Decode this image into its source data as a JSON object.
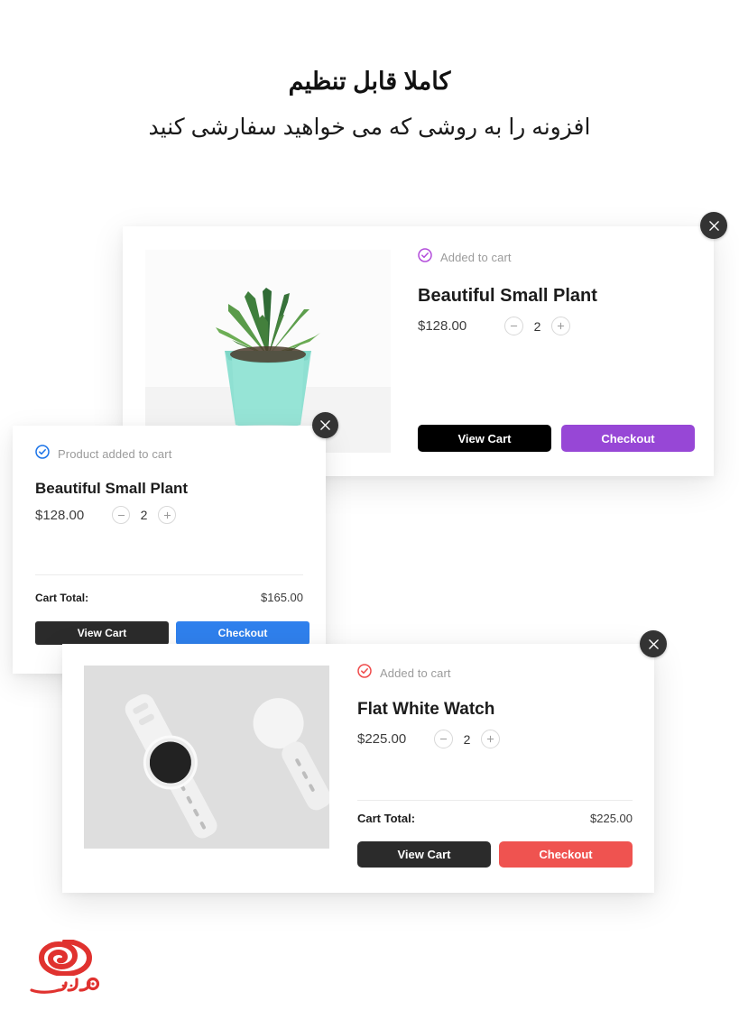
{
  "heading": {
    "title": "کاملا قابل تنظیم",
    "subtitle": "افزونه را به روشی که می خواهید سفارشی کنید"
  },
  "colors": {
    "page_background": "#ffffff",
    "card_background": "#ffffff",
    "purple_checkout": "#9747d6",
    "blue_checkout": "#2f80ed",
    "red_checkout": "#ef5350",
    "black_viewcart": "#000000",
    "dark_viewcart": "#2b2b2b",
    "close_button": "#333333",
    "status_text": "#9b9b9b",
    "check_purple": "#b34ddb",
    "check_blue": "#1a73e8",
    "check_red": "#ef4a4a",
    "logo_red": "#e0322f"
  },
  "cards": [
    {
      "id": "card1",
      "close_icon": "close-icon",
      "status": {
        "icon": "check-circle-icon",
        "icon_color": "#b34ddb",
        "text": "Added to cart"
      },
      "product": {
        "title": "Beautiful Small Plant",
        "price": "$128.00",
        "image_alt": "succulent-plant-in-mint-pot"
      },
      "stepper": {
        "decrease_icon": "minus-icon",
        "increase_icon": "plus-icon",
        "quantity": "2"
      },
      "has_total": false,
      "total": {
        "label": "",
        "value": ""
      },
      "buttons": {
        "view_cart": "View Cart",
        "checkout": "Checkout",
        "view_cart_color": "#000000",
        "checkout_color": "#9747d6"
      }
    },
    {
      "id": "card2",
      "close_icon": "close-icon",
      "status": {
        "icon": "check-circle-icon",
        "icon_color": "#1a73e8",
        "text": "Product added to cart"
      },
      "product": {
        "title": "Beautiful Small Plant",
        "price": "$128.00",
        "image_alt": ""
      },
      "stepper": {
        "decrease_icon": "minus-icon",
        "increase_icon": "plus-icon",
        "quantity": "2"
      },
      "has_total": true,
      "total": {
        "label": "Cart Total:",
        "value": "$165.00"
      },
      "buttons": {
        "view_cart": "View Cart",
        "checkout": "Checkout",
        "view_cart_color": "#2b2b2b",
        "checkout_color": "#2f80ed"
      }
    },
    {
      "id": "card3",
      "close_icon": "close-icon",
      "status": {
        "icon": "check-circle-icon",
        "icon_color": "#ef4a4a",
        "text": "Added to cart"
      },
      "product": {
        "title": "Flat White Watch",
        "price": "$225.00",
        "image_alt": "white-smartwatches-on-gray-background"
      },
      "stepper": {
        "decrease_icon": "minus-icon",
        "increase_icon": "plus-icon",
        "quantity": "2"
      },
      "has_total": true,
      "total": {
        "label": "Cart Total:",
        "value": "$225.00"
      },
      "buttons": {
        "view_cart": "View Cart",
        "checkout": "Checkout",
        "view_cart_color": "#2b2b2b",
        "checkout_color": "#ef5350"
      }
    }
  ],
  "logo": {
    "name": "sedoon-logo",
    "wordmark": "سدون",
    "color": "#e0322f"
  }
}
